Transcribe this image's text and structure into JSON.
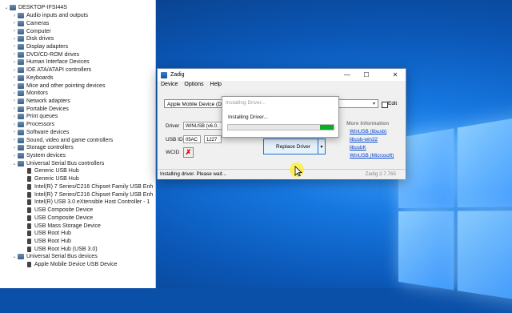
{
  "device_manager": {
    "items": [
      {
        "label": "DESKTOP-IFSI44S",
        "indent": 0,
        "expander": "⌄",
        "icon": "computer-icon"
      },
      {
        "label": "Audio inputs and outputs",
        "indent": 1,
        "expander": "›",
        "icon": "speaker-icon"
      },
      {
        "label": "Cameras",
        "indent": 1,
        "expander": "›",
        "icon": "camera-icon"
      },
      {
        "label": "Computer",
        "indent": 1,
        "expander": "›",
        "icon": "computer-icon"
      },
      {
        "label": "Disk drives",
        "indent": 1,
        "expander": "›",
        "icon": "disk-icon"
      },
      {
        "label": "Display adapters",
        "indent": 1,
        "expander": "›",
        "icon": "display-icon"
      },
      {
        "label": "DVD/CD-ROM drives",
        "indent": 1,
        "expander": "›",
        "icon": "dvd-icon"
      },
      {
        "label": "Human Interface Devices",
        "indent": 1,
        "expander": "›",
        "icon": "hid-icon"
      },
      {
        "label": "IDE ATA/ATAPI controllers",
        "indent": 1,
        "expander": "›",
        "icon": "ide-icon"
      },
      {
        "label": "Keyboards",
        "indent": 1,
        "expander": "›",
        "icon": "keyboard-icon"
      },
      {
        "label": "Mice and other pointing devices",
        "indent": 1,
        "expander": "›",
        "icon": "mouse-icon"
      },
      {
        "label": "Monitors",
        "indent": 1,
        "expander": "›",
        "icon": "monitor-icon"
      },
      {
        "label": "Network adapters",
        "indent": 1,
        "expander": "›",
        "icon": "network-icon"
      },
      {
        "label": "Portable Devices",
        "indent": 1,
        "expander": "›",
        "icon": "portable-icon"
      },
      {
        "label": "Print queues",
        "indent": 1,
        "expander": "›",
        "icon": "printer-icon"
      },
      {
        "label": "Processors",
        "indent": 1,
        "expander": "›",
        "icon": "processor-icon"
      },
      {
        "label": "Software devices",
        "indent": 1,
        "expander": "›",
        "icon": "software-icon"
      },
      {
        "label": "Sound, video and game controllers",
        "indent": 1,
        "expander": "›",
        "icon": "sound-icon"
      },
      {
        "label": "Storage controllers",
        "indent": 1,
        "expander": "›",
        "icon": "storage-icon"
      },
      {
        "label": "System devices",
        "indent": 1,
        "expander": "›",
        "icon": "system-icon"
      },
      {
        "label": "Universal Serial Bus controllers",
        "indent": 1,
        "expander": "⌄",
        "icon": "usb-icon"
      },
      {
        "label": "Generic USB Hub",
        "indent": 2,
        "expander": "",
        "icon": "usb-icon"
      },
      {
        "label": "Generic USB Hub",
        "indent": 2,
        "expander": "",
        "icon": "usb-icon"
      },
      {
        "label": "Intel(R) 7 Series/C216 Chipset Family USB Enh",
        "indent": 2,
        "expander": "",
        "icon": "usb-icon"
      },
      {
        "label": "Intel(R) 7 Series/C216 Chipset Family USB Enh",
        "indent": 2,
        "expander": "",
        "icon": "usb-icon"
      },
      {
        "label": "Intel(R) USB 3.0 eXtensible Host Controller - 1",
        "indent": 2,
        "expander": "",
        "icon": "usb-icon"
      },
      {
        "label": "USB Composite Device",
        "indent": 2,
        "expander": "",
        "icon": "usb-icon"
      },
      {
        "label": "USB Composite Device",
        "indent": 2,
        "expander": "",
        "icon": "usb-icon"
      },
      {
        "label": "USB Mass Storage Device",
        "indent": 2,
        "expander": "",
        "icon": "usb-icon"
      },
      {
        "label": "USB Root Hub",
        "indent": 2,
        "expander": "",
        "icon": "usb-icon"
      },
      {
        "label": "USB Root Hub",
        "indent": 2,
        "expander": "",
        "icon": "usb-icon"
      },
      {
        "label": "USB Root Hub (USB 3.0)",
        "indent": 2,
        "expander": "",
        "icon": "usb-icon"
      },
      {
        "label": "Universal Serial Bus devices",
        "indent": 1,
        "expander": "⌄",
        "icon": "usb-icon"
      },
      {
        "label": "Apple Mobile Device USB Device",
        "indent": 2,
        "expander": "",
        "icon": "usb-icon"
      }
    ]
  },
  "zadig": {
    "title": "Zadig",
    "controls": {
      "minimize": "—",
      "maximize": "☐",
      "close": "✕"
    },
    "menu": [
      "Device",
      "Options",
      "Help"
    ],
    "device_combo": "Apple Mobile Device (DFU Mode)",
    "edit_label": "Edit",
    "driver_label": "Driver",
    "driver_value": "WINUSB (v6.0.",
    "usbid_label": "USB ID",
    "usbid_vid": "05AC",
    "usbid_pid": "1227",
    "wcid_label": "WCID",
    "wcid_mark": "✗",
    "replace_button": "Replace Driver",
    "replace_split": "▾",
    "more_info": {
      "header": "More Information",
      "links": [
        "WinUSB (libusb)",
        "libusb-win32",
        "libusbK",
        "WinUSB (Microsoft)"
      ]
    },
    "status_left": "Installing driver. Please wait...",
    "status_right": "Zadig 2.7.765"
  },
  "popup": {
    "title": "Installing Driver...",
    "message": "Installing Driver...",
    "progress": 0.13
  },
  "colors": {
    "progress_fill": "#06b025",
    "link": "#0044cc",
    "wcid_mark": "#dd0000",
    "accent": "#2b6fc7"
  }
}
